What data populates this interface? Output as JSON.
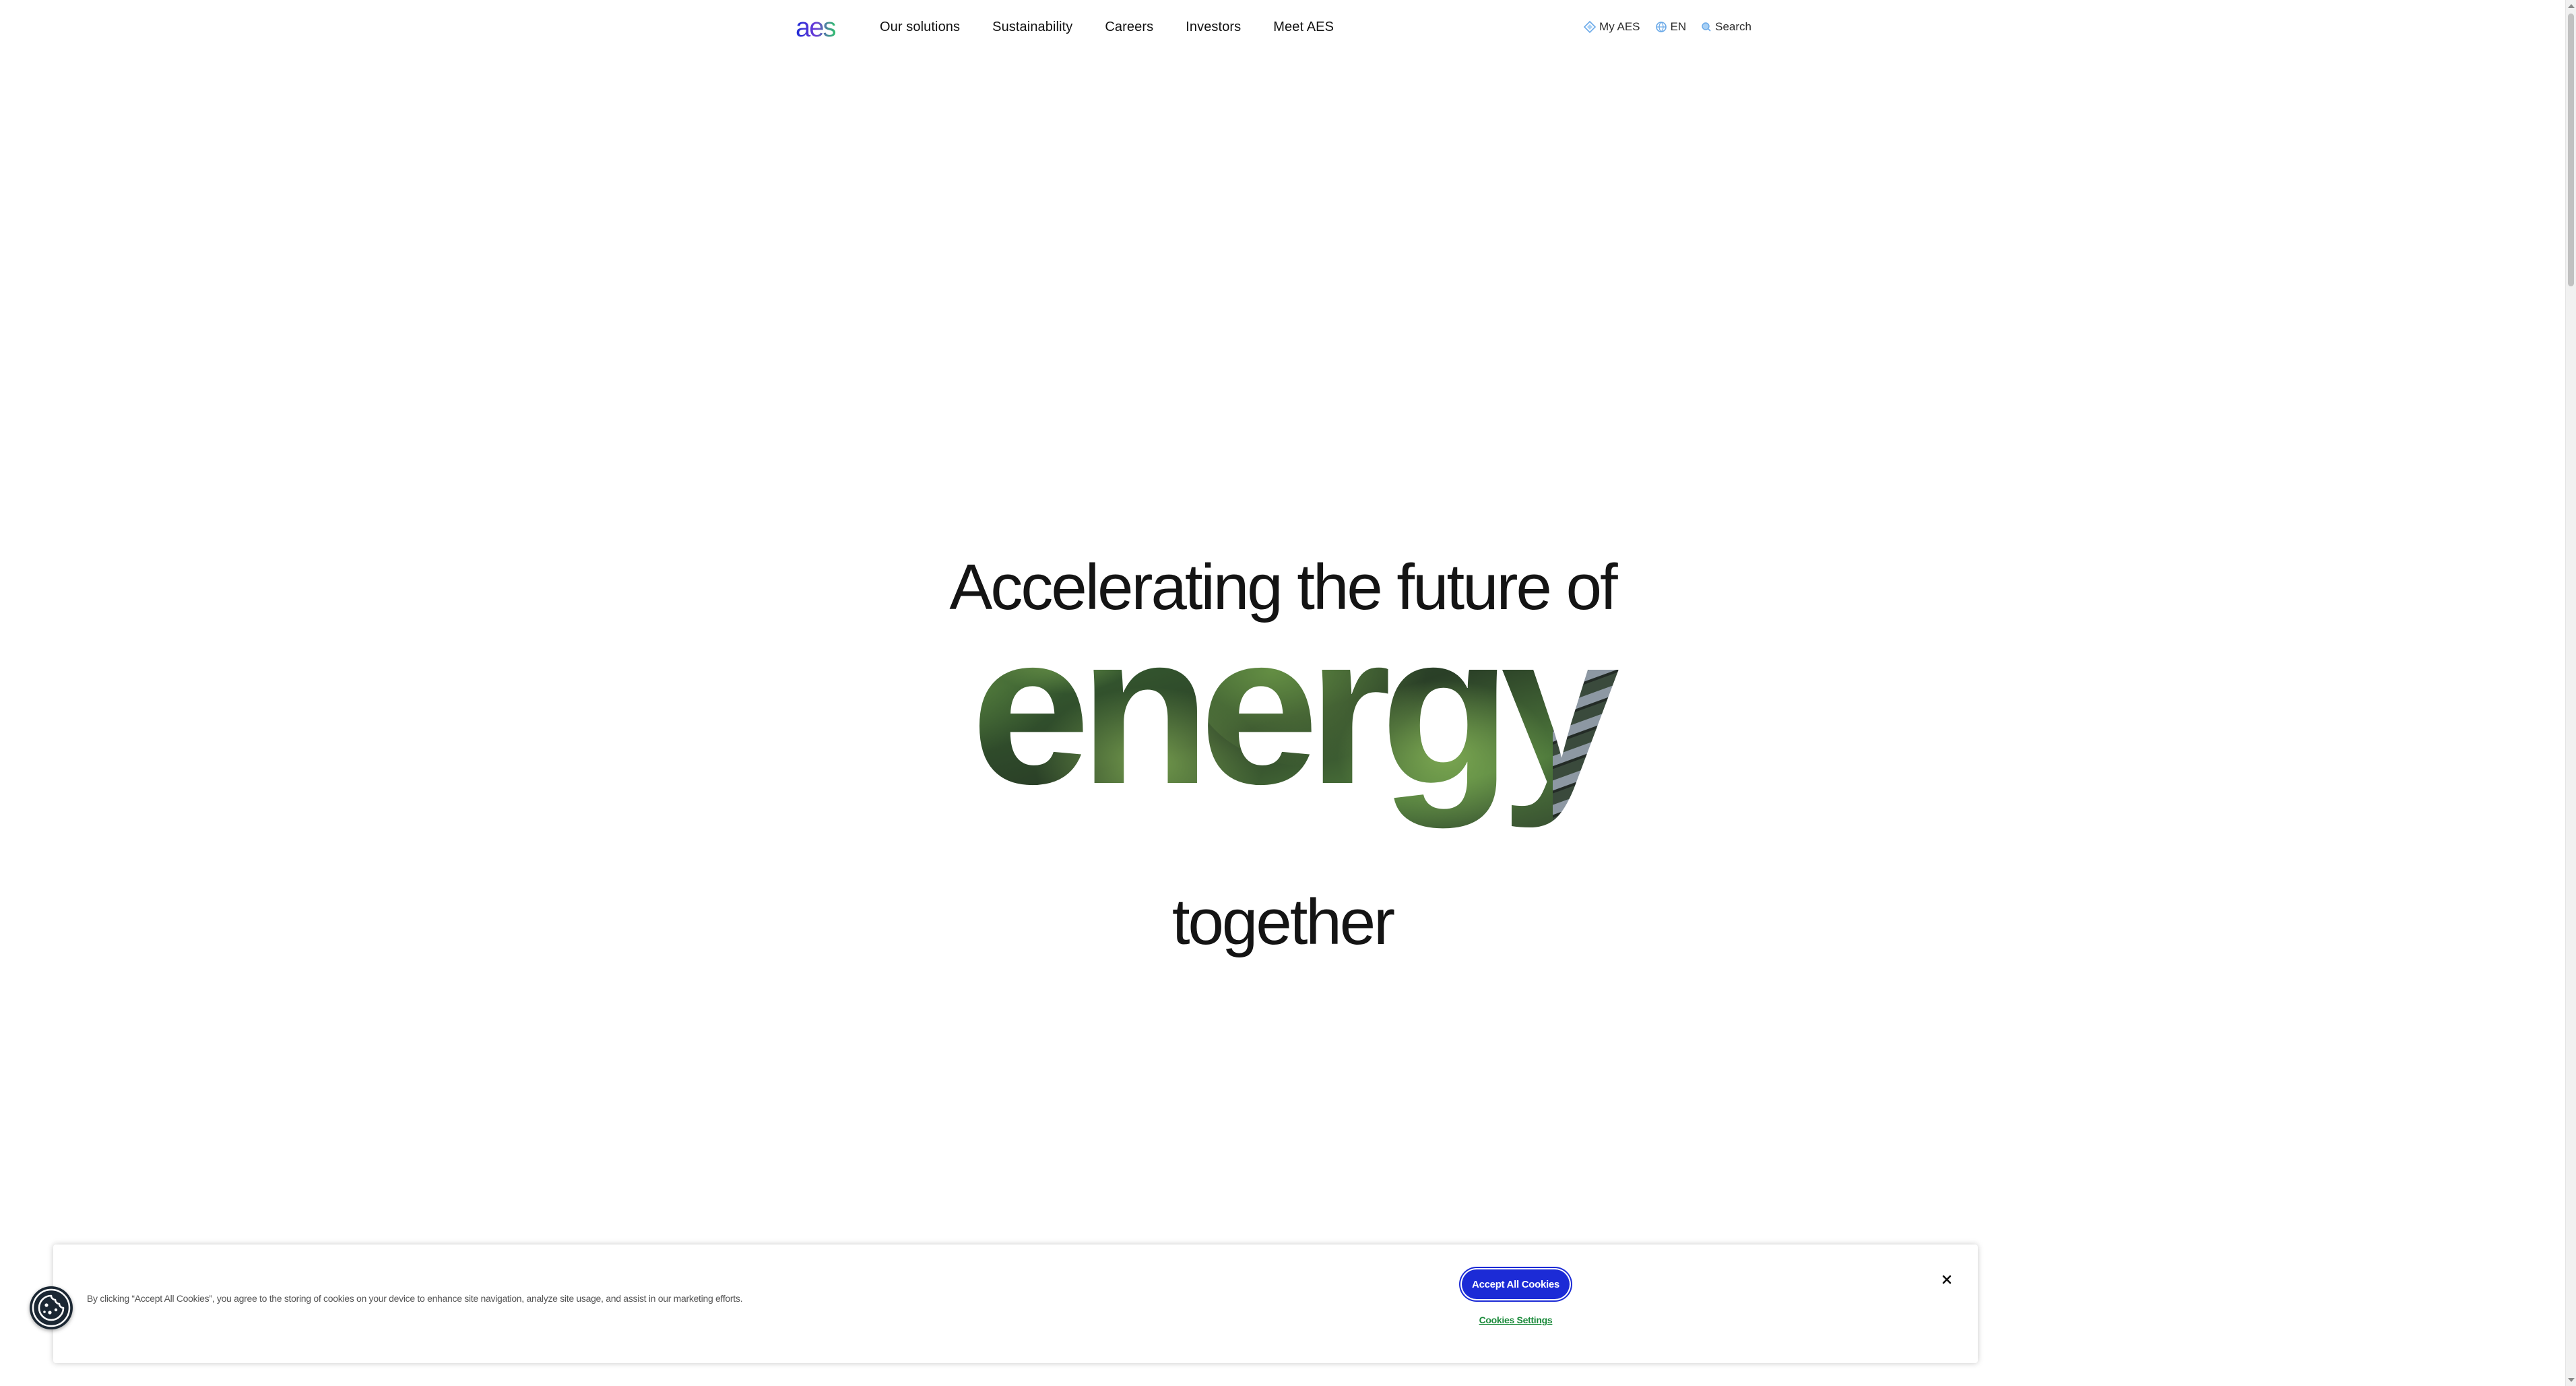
{
  "brand": {
    "logo_text": "aes",
    "colors": {
      "logo_blue": "#1c2bd6",
      "logo_purple": "#6c3bd8",
      "logo_green": "#2fc46b",
      "accent": "#1c2bd6",
      "link_green": "#1a8a3a"
    }
  },
  "header": {
    "nav": [
      {
        "label": "Our solutions"
      },
      {
        "label": "Sustainability"
      },
      {
        "label": "Careers"
      },
      {
        "label": "Investors"
      },
      {
        "label": "Meet AES"
      }
    ],
    "utility": {
      "my_aes": {
        "label": "My AES",
        "icon": "diamond-icon"
      },
      "language": {
        "label": "EN",
        "icon": "globe-icon"
      },
      "search": {
        "label": "Search",
        "icon": "search-icon"
      }
    }
  },
  "hero": {
    "line1": "Accelerating the future of",
    "highlight": "energy",
    "line3": "together",
    "highlight_fill": "forest-and-solar-panel-photo"
  },
  "cookie_banner": {
    "text": "By clicking “Accept All Cookies”, you agree to the storing of cookies on your device to enhance site navigation, analyze site usage, and assist in our marketing efforts.",
    "accept_label": "Accept All Cookies",
    "settings_label": "Cookies Settings",
    "close_icon": "close-icon",
    "preferences_icon": "cookie-icon"
  }
}
